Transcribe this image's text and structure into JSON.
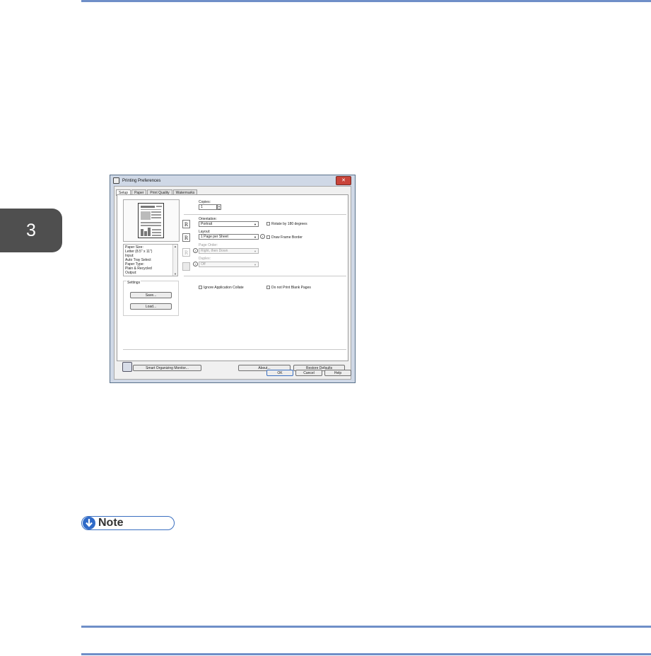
{
  "chapter": {
    "number": "3"
  },
  "note": {
    "label": "Note"
  },
  "dialog": {
    "title": "Printing Preferences",
    "close_glyph": "✕",
    "tabs": [
      "Setup",
      "Paper",
      "Print Quality",
      "Watermarks"
    ],
    "summary_lines": [
      "Paper Size:",
      "  Letter (8.5\" x 11\")",
      "Input:",
      "  Auto Tray Select",
      "Paper Type:",
      "  Plain & Recycled",
      "Output:"
    ],
    "settings": {
      "label": "Settings",
      "save_button": "Save...",
      "load_button": "Load..."
    },
    "copies": {
      "label": "Copies:",
      "value": "1"
    },
    "orientation": {
      "label": "Orientation:",
      "value": "Portrait"
    },
    "rotate": {
      "label": "Rotate by 180 degrees"
    },
    "layout": {
      "label": "Layout:",
      "value": "1 Page per Sheet"
    },
    "frame": {
      "label": "Draw Frame Border"
    },
    "page_order": {
      "label": "Page Order:",
      "value": "Right, then Down"
    },
    "duplex": {
      "label": "Duplex:",
      "value": "Off"
    },
    "collate": {
      "label": "Ignore Application Collate"
    },
    "blank": {
      "label": "Do not Print Blank Pages"
    },
    "monitor_button": "Smart Organizing Monitor...",
    "about_button": "About...",
    "restore_button": "Restore Defaults",
    "ok_button": "OK",
    "cancel_button": "Cancel",
    "help_button": "Help",
    "icon_letter": "R"
  }
}
